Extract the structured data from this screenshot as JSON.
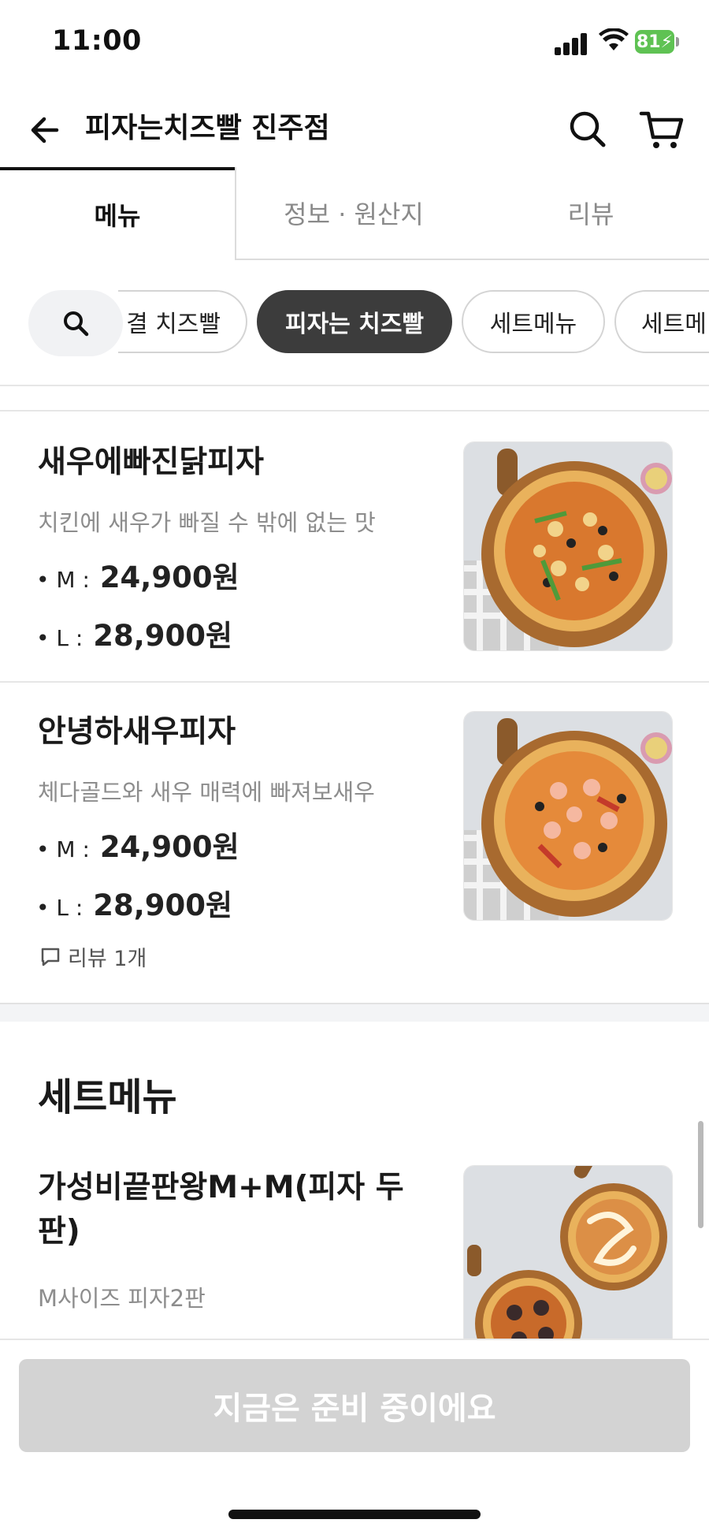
{
  "status_bar": {
    "time": "11:00",
    "battery": "81"
  },
  "header": {
    "title": "피자는치즈빨 진주점"
  },
  "tabs": [
    {
      "label": "메뉴"
    },
    {
      "label": "정보 · 원산지"
    },
    {
      "label": "리뷰"
    }
  ],
  "chips": [
    {
      "label": "결 치즈빨"
    },
    {
      "label": "피자는 치즈빨"
    },
    {
      "label": "세트메뉴"
    },
    {
      "label": "세트메"
    }
  ],
  "items": [
    {
      "name": "새우에빠진닭피자",
      "desc": "치킨에 새우가 빠질 수 밖에 없는 맛",
      "m_label": "• M : ",
      "m_price": "24,900원",
      "l_label": "• L : ",
      "l_price": "28,900원"
    },
    {
      "name": "안녕하새우피자",
      "desc": "체다골드와 새우 매력에 빠져보새우",
      "m_label": "• M : ",
      "m_price": "24,900원",
      "l_label": "• L : ",
      "l_price": "28,900원",
      "review": "리뷰 1개"
    }
  ],
  "set_section": {
    "title": "세트메뉴",
    "item": {
      "name_line1": "가성비끝판왕M+M(피자 두",
      "name_line2": "판)",
      "desc": "M사이즈 피자2판"
    }
  },
  "bottom": {
    "cta": "지금은 준비 중이에요"
  },
  "colors": {
    "active_chip": "#3c3c3c",
    "cta_disabled": "#d3d3d3",
    "battery": "#5fc253"
  }
}
